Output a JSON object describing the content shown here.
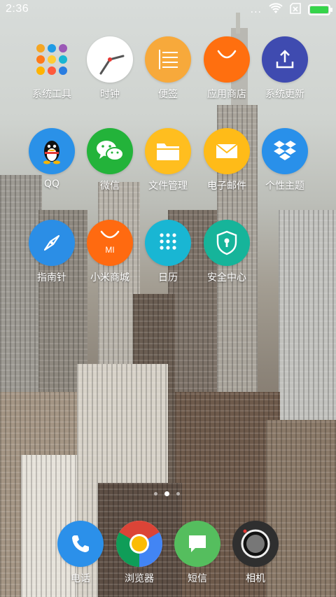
{
  "status_bar": {
    "time": "2:36",
    "more_text": "...",
    "icons": [
      "more-dots-icon",
      "wifi-icon",
      "sim-card-icon",
      "battery-icon"
    ],
    "battery_level": 1.0,
    "battery_color": "#35d44a"
  },
  "apps": [
    {
      "label": "系统工具",
      "icon": "tools-folder-icon",
      "color": "transparent"
    },
    {
      "label": "时钟",
      "icon": "clock-icon",
      "color": "#ffffff"
    },
    {
      "label": "便签",
      "icon": "notes-icon",
      "color": "#f7a93b"
    },
    {
      "label": "应用商店",
      "icon": "app-store-bag-icon",
      "color": "#ff6f0f"
    },
    {
      "label": "系统更新",
      "icon": "upload-icon",
      "color": "#3f4bb0"
    },
    {
      "label": "QQ",
      "icon": "qq-penguin-icon",
      "color": "#2a91e8"
    },
    {
      "label": "微信",
      "icon": "wechat-icon",
      "color": "#23b33a"
    },
    {
      "label": "文件管理",
      "icon": "folder-icon",
      "color": "#ffbe1f"
    },
    {
      "label": "电子邮件",
      "icon": "mail-icon",
      "color": "#ffbb18"
    },
    {
      "label": "个性主题",
      "icon": "dropbox-icon",
      "color": "#2990ea"
    },
    {
      "label": "指南针",
      "icon": "compass-icon",
      "color": "#2b8ee6"
    },
    {
      "label": "小米商城",
      "icon": "mi-store-bag-icon",
      "color": "#ff6a10"
    },
    {
      "label": "日历",
      "icon": "dial-pad-icon",
      "color": "#19b6d3"
    },
    {
      "label": "安全中心",
      "icon": "shield-icon",
      "color": "#16b49a"
    }
  ],
  "mi_text": "MI",
  "dock": [
    {
      "label": "电话",
      "icon": "phone-icon",
      "color": "#2b90ea"
    },
    {
      "label": "浏览器",
      "icon": "browser-icon",
      "color": "#ffffff"
    },
    {
      "label": "短信",
      "icon": "message-icon",
      "color": "#55be5e"
    },
    {
      "label": "相机",
      "icon": "camera-icon",
      "color": "#2f2f2f"
    }
  ],
  "pages": {
    "count": 3,
    "active": 1
  }
}
